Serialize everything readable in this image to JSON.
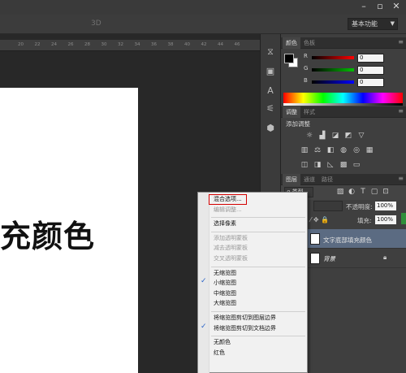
{
  "options_bar": {
    "label_3d": "3D",
    "workspace": "基本功能"
  },
  "window_controls": [
    "–",
    "▫",
    "✕"
  ],
  "ruler_ticks": [
    "20",
    "22",
    "24",
    "26",
    "28",
    "30",
    "32",
    "34",
    "36",
    "38",
    "40",
    "42",
    "44",
    "46"
  ],
  "canvas": {
    "text": "充颜色"
  },
  "panels": {
    "color_tabs": [
      "颜色",
      "色板"
    ],
    "channels": [
      {
        "label": "R",
        "value": "0",
        "color": "#ff0000"
      },
      {
        "label": "G",
        "value": "0",
        "color": "#00c000"
      },
      {
        "label": "B",
        "value": "0",
        "color": "#0000ff"
      }
    ],
    "adjust_tabs": [
      "调整",
      "样式"
    ],
    "add_adjustment": "添加调整",
    "layers_tabs": [
      "图层",
      "通道",
      "路径"
    ],
    "kind_filter": "ρ 类型",
    "opacity_label": "不透明度:",
    "opacity_value": "100%",
    "fill_label": "填充:",
    "fill_value": "100%",
    "lock_label": "⁄ ✥ 🔒",
    "layers": [
      {
        "name": "文字底部填充颜色",
        "selected": true
      },
      {
        "name": "背景",
        "selected": false
      }
    ]
  },
  "context_menu": {
    "items": [
      {
        "label": "混合选项...",
        "disabled": false,
        "checked": false,
        "highlighted": true
      },
      {
        "label": "编辑调整...",
        "disabled": true,
        "checked": false
      },
      {
        "sep": true
      },
      {
        "label": "选择像素",
        "disabled": false,
        "checked": false
      },
      {
        "sep": true
      },
      {
        "label": "添加透明蒙板",
        "disabled": true,
        "checked": false
      },
      {
        "label": "减去透明蒙板",
        "disabled": true,
        "checked": false
      },
      {
        "label": "交叉透明蒙板",
        "disabled": true,
        "checked": false
      },
      {
        "sep": true
      },
      {
        "label": "无缩览图",
        "disabled": false,
        "checked": false
      },
      {
        "label": "小缩览图",
        "disabled": false,
        "checked": true
      },
      {
        "label": "中缩览图",
        "disabled": false,
        "checked": false
      },
      {
        "label": "大缩览图",
        "disabled": false,
        "checked": false
      },
      {
        "sep": true
      },
      {
        "label": "将缩览图剪切到图层边界",
        "disabled": false,
        "checked": false
      },
      {
        "label": "将缩览图剪切到文档边界",
        "disabled": false,
        "checked": true
      },
      {
        "sep": true
      },
      {
        "label": "无颜色",
        "disabled": false,
        "checked": false
      },
      {
        "label": "红色",
        "disabled": false,
        "checked": false
      }
    ]
  }
}
